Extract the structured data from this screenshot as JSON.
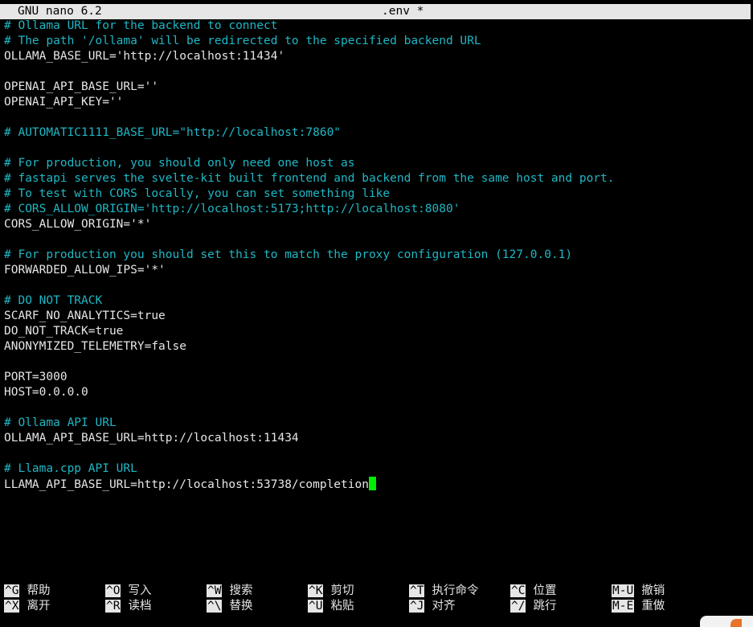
{
  "titlebar": {
    "app": "GNU nano 6.2",
    "filename": ".env *"
  },
  "editor": {
    "lines": [
      {
        "type": "comment",
        "text": "# Ollama URL for the backend to connect"
      },
      {
        "type": "comment",
        "text": "# The path '/ollama' will be redirected to the specified backend URL"
      },
      {
        "type": "code",
        "text": "OLLAMA_BASE_URL='http://localhost:11434'"
      },
      {
        "type": "blank",
        "text": ""
      },
      {
        "type": "code",
        "text": "OPENAI_API_BASE_URL=''"
      },
      {
        "type": "code",
        "text": "OPENAI_API_KEY=''"
      },
      {
        "type": "blank",
        "text": ""
      },
      {
        "type": "comment",
        "text": "# AUTOMATIC1111_BASE_URL=\"http://localhost:7860\""
      },
      {
        "type": "blank",
        "text": ""
      },
      {
        "type": "comment",
        "text": "# For production, you should only need one host as"
      },
      {
        "type": "comment",
        "text": "# fastapi serves the svelte-kit built frontend and backend from the same host and port."
      },
      {
        "type": "comment",
        "text": "# To test with CORS locally, you can set something like"
      },
      {
        "type": "comment",
        "text": "# CORS_ALLOW_ORIGIN='http://localhost:5173;http://localhost:8080'"
      },
      {
        "type": "code",
        "text": "CORS_ALLOW_ORIGIN='*'"
      },
      {
        "type": "blank",
        "text": ""
      },
      {
        "type": "comment",
        "text": "# For production you should set this to match the proxy configuration (127.0.0.1)"
      },
      {
        "type": "code",
        "text": "FORWARDED_ALLOW_IPS='*'"
      },
      {
        "type": "blank",
        "text": ""
      },
      {
        "type": "comment",
        "text": "# DO NOT TRACK"
      },
      {
        "type": "code",
        "text": "SCARF_NO_ANALYTICS=true"
      },
      {
        "type": "code",
        "text": "DO_NOT_TRACK=true"
      },
      {
        "type": "code",
        "text": "ANONYMIZED_TELEMETRY=false"
      },
      {
        "type": "blank",
        "text": ""
      },
      {
        "type": "code",
        "text": "PORT=3000"
      },
      {
        "type": "code",
        "text": "HOST=0.0.0.0"
      },
      {
        "type": "blank",
        "text": ""
      },
      {
        "type": "comment",
        "text": "# Ollama API URL"
      },
      {
        "type": "code",
        "text": "OLLAMA_API_BASE_URL=http://localhost:11434"
      },
      {
        "type": "blank",
        "text": ""
      },
      {
        "type": "comment",
        "text": "# Llama.cpp API URL"
      },
      {
        "type": "code",
        "text": "LLAMA_API_BASE_URL=http://localhost:53738/completion",
        "cursor": true
      }
    ]
  },
  "shortcuts": {
    "rows": [
      [
        {
          "key": "^G",
          "label": "帮助",
          "name": "help"
        },
        {
          "key": "^O",
          "label": "写入",
          "name": "write-out"
        },
        {
          "key": "^W",
          "label": "搜索",
          "name": "where-is"
        },
        {
          "key": "^K",
          "label": "剪切",
          "name": "cut"
        },
        {
          "key": "^T",
          "label": "执行命令",
          "name": "execute"
        },
        {
          "key": "^C",
          "label": "位置",
          "name": "location"
        },
        {
          "key": "M-U",
          "label": "撤销",
          "name": "undo"
        }
      ],
      [
        {
          "key": "^X",
          "label": "离开",
          "name": "exit"
        },
        {
          "key": "^R",
          "label": "读档",
          "name": "read-file"
        },
        {
          "key": "^\\",
          "label": "替换",
          "name": "replace"
        },
        {
          "key": "^U",
          "label": "粘贴",
          "name": "paste"
        },
        {
          "key": "^J",
          "label": "对齐",
          "name": "justify"
        },
        {
          "key": "^/",
          "label": "跳行",
          "name": "go-to-line"
        },
        {
          "key": "M-E",
          "label": "重做",
          "name": "redo"
        }
      ]
    ]
  },
  "colors": {
    "comment": "#1fb7c4",
    "text": "#e6e6e6",
    "background": "#000000",
    "cursor": "#00ee00",
    "titlebar_bg": "#e6e6e6"
  }
}
